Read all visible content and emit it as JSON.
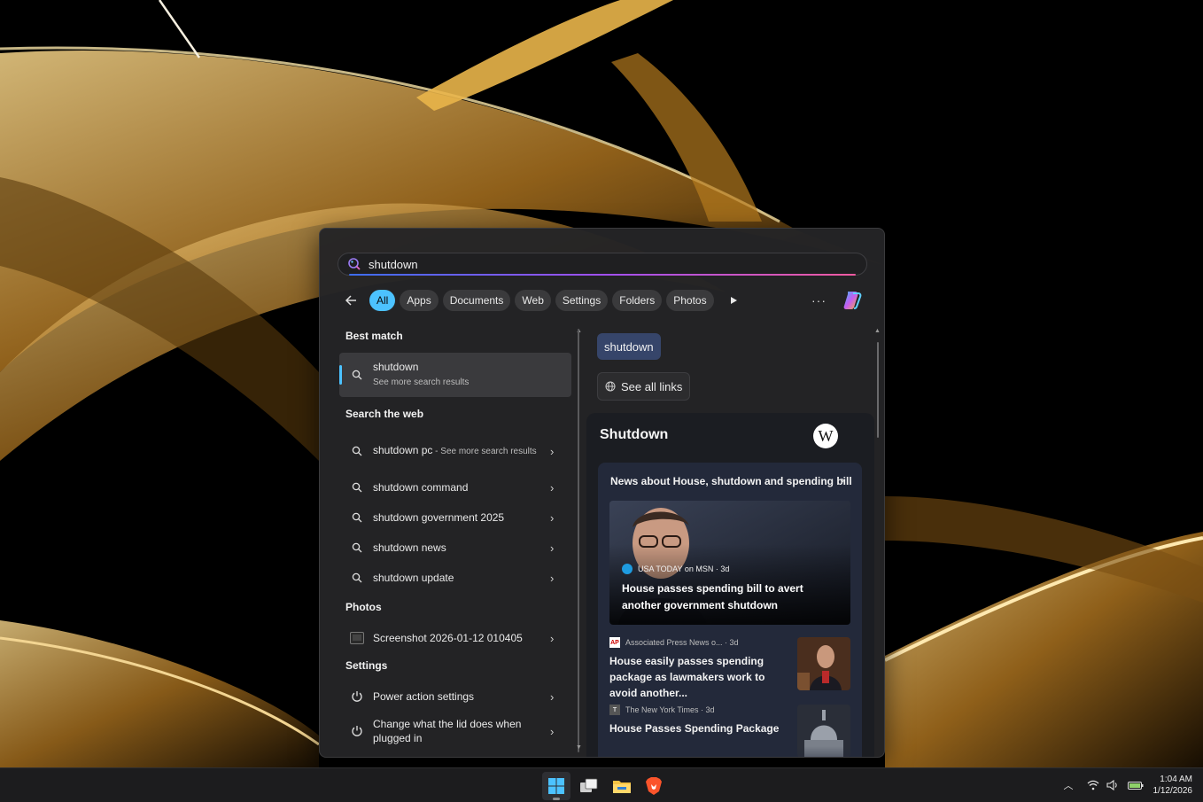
{
  "search": {
    "query": "shutdown"
  },
  "filters": [
    "All",
    "Apps",
    "Documents",
    "Web",
    "Settings",
    "Folders",
    "Photos"
  ],
  "filters_more": "···",
  "sections": {
    "best_match": "Best match",
    "search_web": "Search the web",
    "photos": "Photos",
    "settings": "Settings"
  },
  "best_match": {
    "title": "shutdown",
    "subtitle": "See more search results"
  },
  "web_results": [
    {
      "main": "shutdown pc",
      "sub": " - See more search results"
    },
    {
      "main": "shutdown command"
    },
    {
      "main": "shutdown government 2025"
    },
    {
      "main": "shutdown news"
    },
    {
      "main": "shutdown update"
    }
  ],
  "photos": [
    {
      "title": "Screenshot 2026-01-12 010405"
    }
  ],
  "settings": [
    {
      "title": "Power action settings"
    },
    {
      "title": "Change what the lid does when plugged in"
    }
  ],
  "preview": {
    "query_chip": "shutdown",
    "see_all": "See all links",
    "wiki_title": "Shutdown",
    "wiki_logo": "W",
    "news_header": "News about House, shutdown and spending bill",
    "hero": {
      "source": "USA TODAY on MSN · 3d",
      "title": "House passes spending bill to avert another government shutdown"
    },
    "stories": [
      {
        "badge": "AP",
        "source": "Associated Press News o... · 3d",
        "title": "House easily passes spending package as lawmakers work to avoid another..."
      },
      {
        "badge": "T",
        "source": "The New York Times · 3d",
        "title": "House Passes Spending Package"
      }
    ]
  },
  "clock": {
    "time": "1:04 AM",
    "date": "1/12/2026"
  },
  "colors": {
    "accent": "#4cc2ff",
    "panel": "#242426",
    "news_card": "#23293a"
  }
}
